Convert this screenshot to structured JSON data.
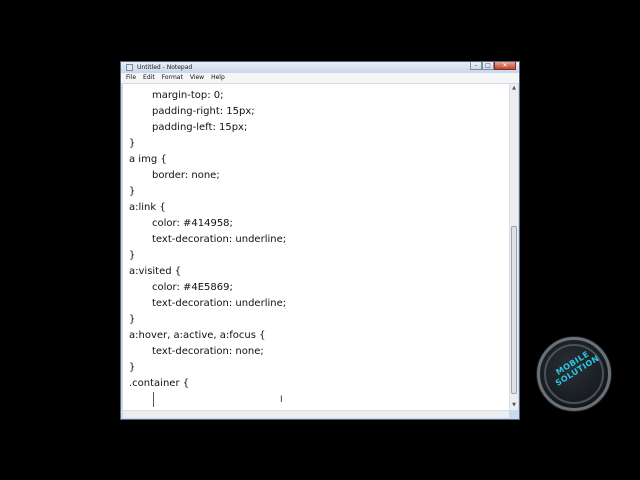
{
  "window": {
    "title": "Untitled - Notepad",
    "app_icon": "notepad-icon",
    "minimize_glyph": "–",
    "maximize_glyph": "□",
    "close_glyph": "✕"
  },
  "menu": {
    "items": [
      "File",
      "Edit",
      "Format",
      "View",
      "Help"
    ]
  },
  "editor": {
    "lines": [
      {
        "text": "margin-top: 0;",
        "indent": true
      },
      {
        "text": "padding-right: 15px;",
        "indent": true
      },
      {
        "text": "padding-left: 15px;",
        "indent": true
      },
      {
        "text": "}",
        "indent": false
      },
      {
        "text": "a img {",
        "indent": false
      },
      {
        "text": "border: none;",
        "indent": true
      },
      {
        "text": "}",
        "indent": false
      },
      {
        "text": "a:link {",
        "indent": false
      },
      {
        "text": "color: #414958;",
        "indent": true
      },
      {
        "text": "text-decoration: underline;",
        "indent": true
      },
      {
        "text": "}",
        "indent": false
      },
      {
        "text": "a:visited {",
        "indent": false
      },
      {
        "text": "color: #4E5869;",
        "indent": true
      },
      {
        "text": "text-decoration: underline;",
        "indent": true
      },
      {
        "text": "}",
        "indent": false
      },
      {
        "text": "a:hover, a:active, a:focus {",
        "indent": false
      },
      {
        "text": "text-decoration: none;",
        "indent": true
      },
      {
        "text": "}",
        "indent": false
      },
      {
        "text": ".container {",
        "indent": false
      }
    ]
  },
  "scrollbar": {
    "up_arrow_glyph": "▲",
    "down_arrow_glyph": "▼",
    "position_fraction": 0.75
  },
  "watermark": {
    "text": "MOBILE SOLUTION",
    "text_color": "#26c9e6"
  }
}
